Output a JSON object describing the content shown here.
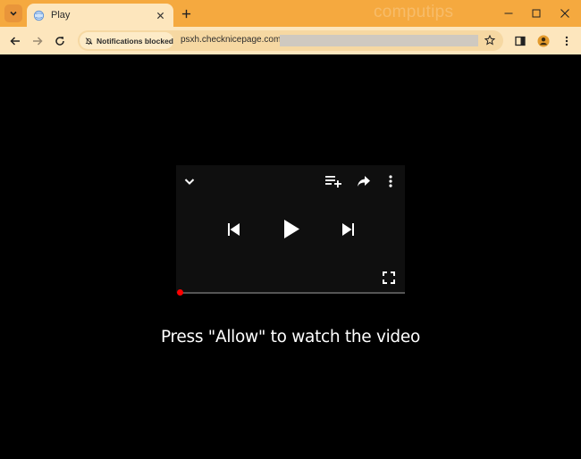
{
  "browser": {
    "tab": {
      "title": "Play"
    },
    "watermark": "computips",
    "toolbar": {
      "notification_chip": "Notifications blocked",
      "url": "psxh.checknicepage.com/"
    }
  },
  "page": {
    "caption": "Press \"Allow\" to watch the video",
    "player": {
      "progress_fraction": 0
    }
  },
  "colors": {
    "tabstrip": "#f5a93f",
    "toolbar": "#fde6bd",
    "progress_dot": "#ff0000"
  }
}
